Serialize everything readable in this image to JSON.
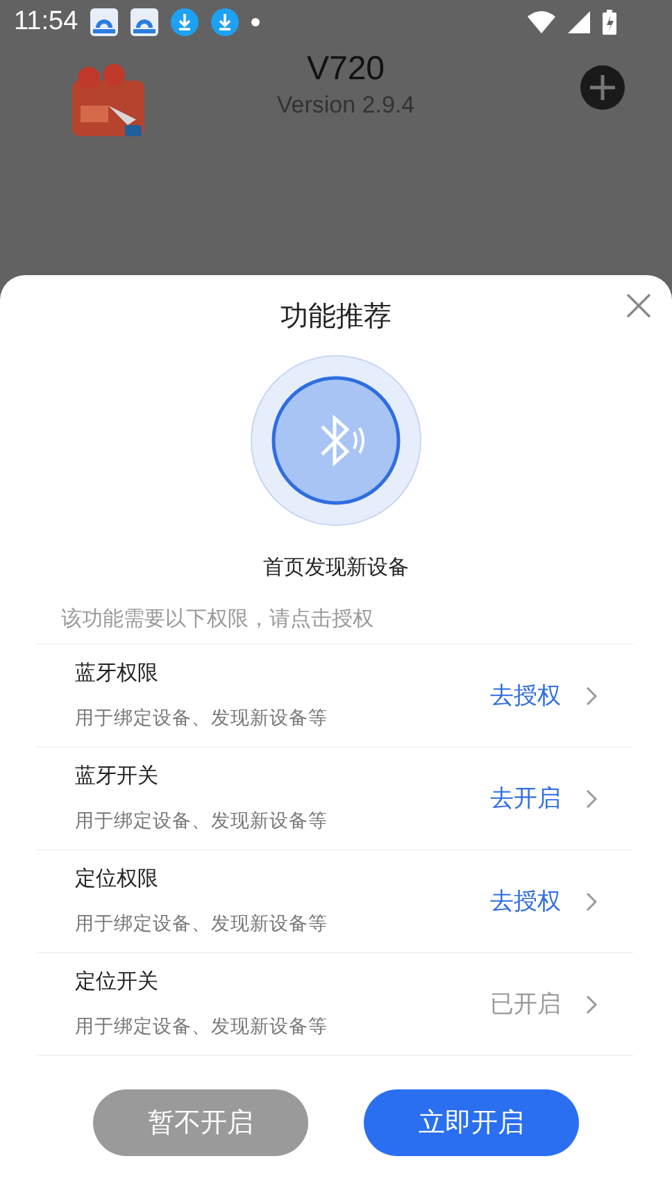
{
  "status_bar": {
    "time": "11:54"
  },
  "header": {
    "title": "V720",
    "version": "Version 2.9.4"
  },
  "sheet": {
    "title": "功能推荐",
    "feature_label": "首页发现新设备",
    "notice": "该功能需要以下权限，请点击授权",
    "permissions": [
      {
        "name": "蓝牙权限",
        "description": "用于绑定设备、发现新设备等",
        "action": "去授权",
        "granted": false
      },
      {
        "name": "蓝牙开关",
        "description": "用于绑定设备、发现新设备等",
        "action": "去开启",
        "granted": false
      },
      {
        "name": "定位权限",
        "description": "用于绑定设备、发现新设备等",
        "action": "去授权",
        "granted": false
      },
      {
        "name": "定位开关",
        "description": "用于绑定设备、发现新设备等",
        "action": "已开启",
        "granted": true
      }
    ],
    "buttons": [
      {
        "label": "暂不开启",
        "kind": "secondary"
      },
      {
        "label": "立即开启",
        "kind": "primary"
      }
    ]
  }
}
